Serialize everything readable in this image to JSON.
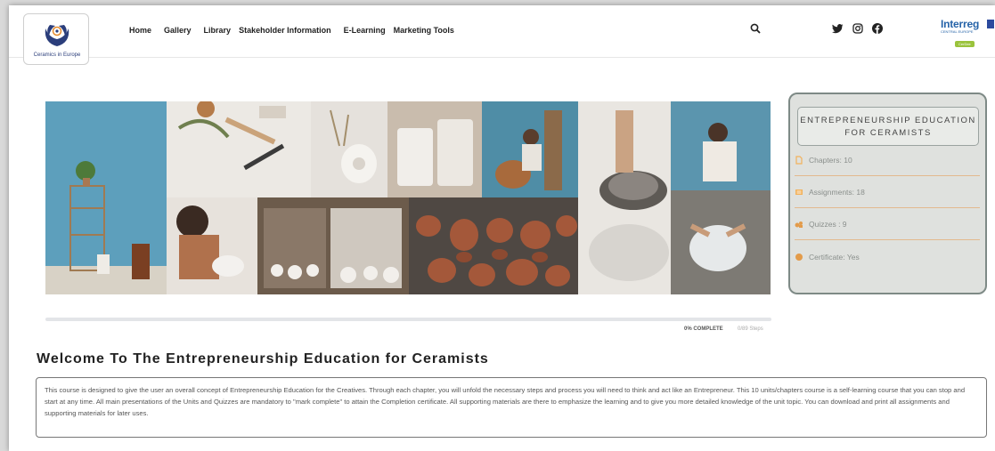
{
  "header": {
    "logo_text": "Ceramics in Europe",
    "nav": [
      "Home",
      "Gallery",
      "Library",
      "Stakeholder Information",
      "E-Learning",
      "Marketing Tools"
    ],
    "brand": {
      "title": "Interreg",
      "subtitle": "CENTRAL EUROPE",
      "pill": "CerDee"
    }
  },
  "course_card": {
    "title": "ENTREPRENEURSHIP EDUCATION FOR CERAMISTS",
    "rows": [
      {
        "icon": "document-icon",
        "label": "Chapters: 10",
        "color": "#f2b25c"
      },
      {
        "icon": "assignment-icon",
        "label": "Assignments: 18",
        "color": "#f2b25c"
      },
      {
        "icon": "quiz-icon",
        "label": "Quizzes : 9",
        "color": "#e39b4a"
      },
      {
        "icon": "certificate-icon",
        "label": "Certificate: Yes",
        "color": "#e39b4a"
      }
    ]
  },
  "progress": {
    "percent": 0,
    "label": "0% COMPLETE",
    "steps": "0/89 Steps"
  },
  "welcome_title": "Welcome To The Entrepreneurship Education for Ceramists",
  "description": "This course is designed to give the user an overall concept of Entrepreneurship Education for the Creatives. Through each chapter, you will unfold the necessary steps and process you will need to think and act like an Entrepreneur. This 10 units/chapters course is a self-learning course that you can stop and start at any time. All main presentations of the Units and Quizzes are mandatory to \"mark complete\" to attain the Completion certificate. All supporting materials are there to emphasize the learning and to give you more detailed knowledge of the unit topic. You can download and print all assignments and supporting materials for later uses.",
  "colors": {
    "accent": "#9ac33c",
    "card_bg": "#dfe1de",
    "nav_text": "#222222"
  }
}
